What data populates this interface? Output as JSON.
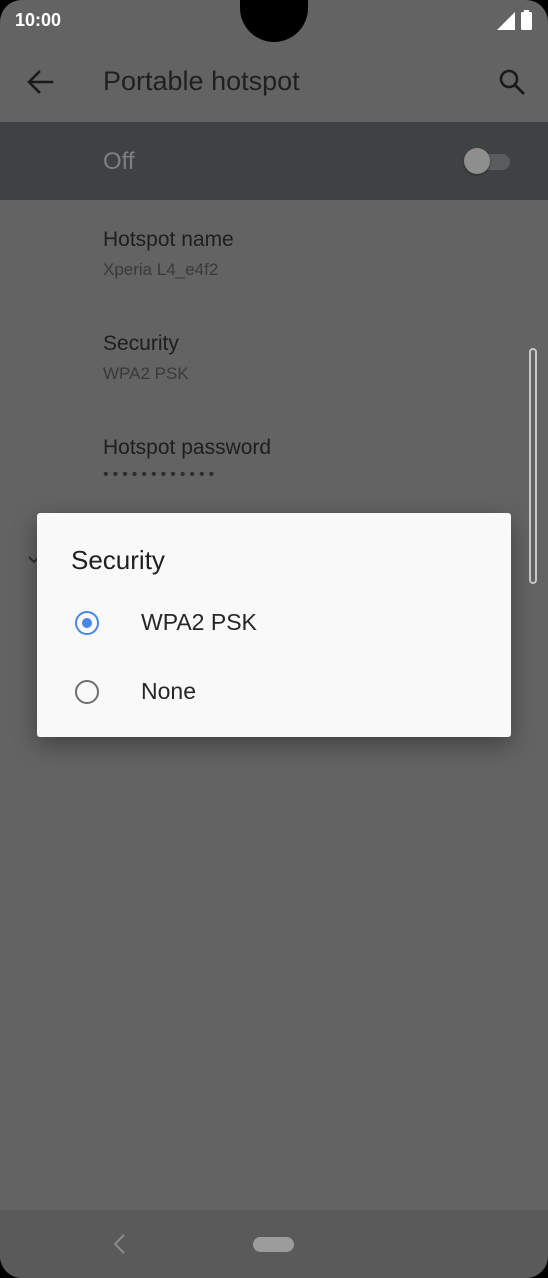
{
  "status_bar": {
    "time": "10:00",
    "signal_icon": "signal-icon",
    "battery_icon": "battery-icon"
  },
  "app_bar": {
    "title": "Portable hotspot",
    "back_icon": "arrow-left-icon",
    "search_icon": "search-icon"
  },
  "master_switch": {
    "label": "Off",
    "state": "off"
  },
  "preferences": [
    {
      "title": "Hotspot name",
      "subtitle": "Xperia L4_e4f2"
    },
    {
      "title": "Security",
      "subtitle": "WPA2 PSK"
    },
    {
      "title": "Hotspot password",
      "subtitle": "••••••••••••"
    }
  ],
  "dialog": {
    "title": "Security",
    "options": [
      {
        "label": "WPA2 PSK",
        "selected": true
      },
      {
        "label": "None",
        "selected": false
      }
    ]
  },
  "colors": {
    "accent": "#4a86e8",
    "scrim": "#636363",
    "dialog_bg": "#f9f9f9"
  },
  "nav_bar": {
    "back_icon": "nav-back-icon",
    "home_icon": "home-pill-icon"
  }
}
